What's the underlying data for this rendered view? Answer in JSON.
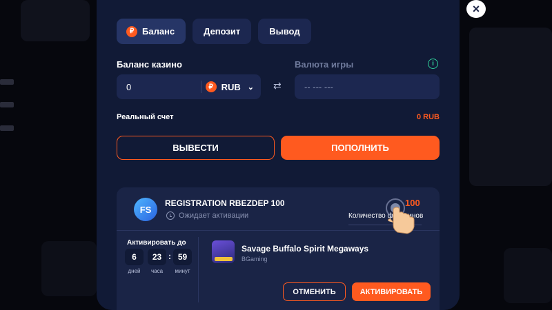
{
  "header": {
    "close_label": "×"
  },
  "tabs": [
    {
      "label": "Баланс",
      "active": true,
      "icon": "ruble-coin-icon"
    },
    {
      "label": "Депозит",
      "active": false
    },
    {
      "label": "Вывод",
      "active": false
    }
  ],
  "balance": {
    "casino_label": "Баланс казино",
    "casino_value": "0",
    "currency": "RUB",
    "currency_symbol": "₽",
    "game_currency_label": "Валюта игры",
    "game_currency_value": "-- --- ---",
    "real_account_label": "Реальный счет",
    "real_account_value": "0 RUB"
  },
  "actions": {
    "withdraw_label": "ВЫВЕСТИ",
    "deposit_label": "ПОПОЛНИТЬ"
  },
  "bonus": {
    "badge": "FS",
    "title": "REGISTRATION RBEZDEP 100",
    "status": "Ожидает активации",
    "freespins_count": "100",
    "freespins_label": "Количество фриспинов",
    "activate_until_label": "Активировать до",
    "timer": [
      {
        "value": "6",
        "unit": "дней"
      },
      {
        "value": "23",
        "unit": "часа"
      },
      {
        "value": "59",
        "unit": "минут"
      }
    ],
    "game_name": "Savage Buffalo Spirit Megaways",
    "game_provider": "BGaming",
    "cancel_label": "ОТМЕНИТЬ",
    "activate_label": "АКТИВИРОВАТЬ"
  },
  "colors": {
    "accent": "#ff5a1f",
    "modal_bg": "#111a36",
    "panel_bg": "#1a2446",
    "info": "#2fd19a"
  }
}
